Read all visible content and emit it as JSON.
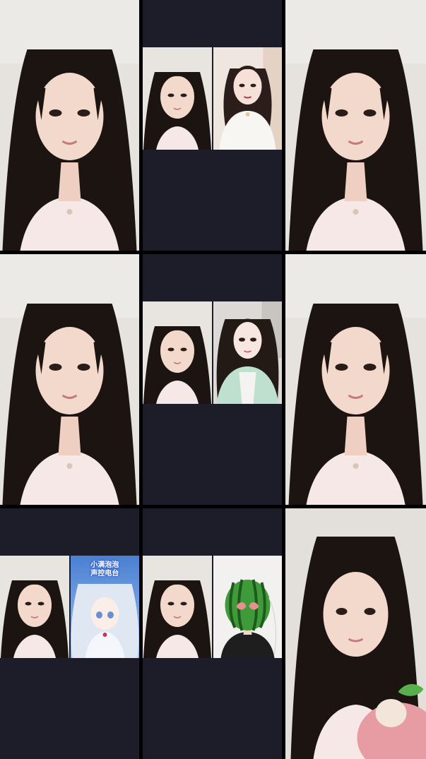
{
  "grid": {
    "background": "#000000",
    "empty_area_color": "#1c1d28",
    "tiles": [
      {
        "id": "r1c1",
        "layout": "solo"
      },
      {
        "id": "r1c2",
        "layout": "split",
        "left": "streamer",
        "right": "guest-woman-white-top"
      },
      {
        "id": "r1c3",
        "layout": "solo"
      },
      {
        "id": "r2c1",
        "layout": "solo"
      },
      {
        "id": "r2c2",
        "layout": "split",
        "left": "streamer",
        "right": "guest-woman-green-cardigan"
      },
      {
        "id": "r2c3",
        "layout": "solo"
      },
      {
        "id": "r3c1",
        "layout": "split",
        "left": "streamer",
        "right": "anime-avatar"
      },
      {
        "id": "r3c2",
        "layout": "split",
        "left": "streamer",
        "right": "watermelon-mask-guest"
      },
      {
        "id": "r3c3",
        "layout": "solo"
      }
    ]
  },
  "anime_banner": {
    "line1": "小满泡泡",
    "line2": "声控电台"
  },
  "colors": {
    "hair": "#1c1410",
    "skin": "#f3d9cc",
    "wall": "#e6e2dd",
    "shirt": "#f6e8e6",
    "anime_sky": "#5a86d0",
    "watermelon": "#3f9a3a"
  }
}
